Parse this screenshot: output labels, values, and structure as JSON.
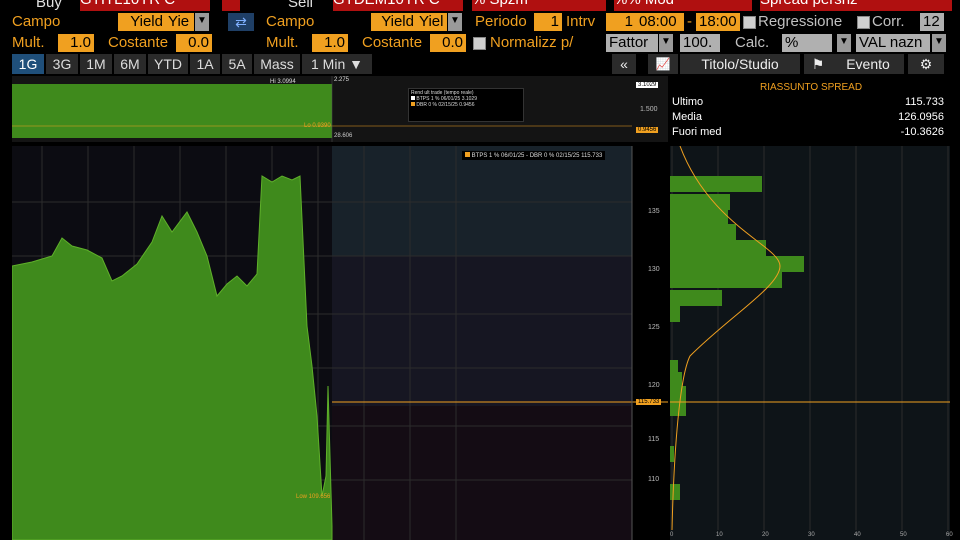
{
  "top": {
    "buy_label": "Buy",
    "buy_ticker": "GTITL10YR C",
    "sell_label": "Sell",
    "sell_ticker": "GTDEM10YR C",
    "mode1": "% Spzm",
    "mode2": "%% Mod",
    "spread_label": "Spread persnz"
  },
  "row1": {
    "campo1_label": "Campo",
    "campo1_value": "Yield",
    "campo1_value2": "Yie",
    "campo2_label": "Campo",
    "campo2_value": "Yield",
    "campo2_value2": "Yiel",
    "periodo_label": "Periodo",
    "periodo_value": "1",
    "intrv_label": "Intrv",
    "intrv_value": "1",
    "time_from": "08:00",
    "time_to": "18:00",
    "regressione_label": "Regressione",
    "corr_label": "Corr.",
    "corr_value": "12"
  },
  "row2": {
    "mult1_label": "Mult.",
    "mult1_value": "1.0",
    "costante1_label": "Costante",
    "costante1_value": "0.0",
    "mult2_label": "Mult.",
    "mult2_value": "1.0",
    "costante2_label": "Costante",
    "costante2_value": "0.0",
    "normalizz_label": "Normalizz p/",
    "fattor_label": "Fattor",
    "fattor_value": "100.",
    "calc_label": "Calc.",
    "calc_value": "%",
    "val_label": "VAL nazn"
  },
  "tabs": [
    "1G",
    "3G",
    "1M",
    "6M",
    "YTD",
    "1A",
    "5A",
    "Mass",
    "1 Min"
  ],
  "toolbar": {
    "collapse": "«",
    "titolo_studio": "Titolo/Studio",
    "evento": "Evento"
  },
  "overview": {
    "legend_title": "Rend ult trade (tempo reale)",
    "legend_btps": "BTPS 1 % 06/01/25  3.1029",
    "legend_dbr": "DBR 0 % 02/15/25  0.9456",
    "right_val_top": "3.1029",
    "right_val_mid": "1.500",
    "right_val_bot": "0.9456",
    "hint_left": "Hi  3.0994",
    "hint_mid": "Lo  0.9390",
    "hint_top": "2.275",
    "hint_bot": "28.606"
  },
  "summary": {
    "title": "RIASSUNTO SPREAD",
    "rows": [
      {
        "label": "Ultimo",
        "value": "115.733"
      },
      {
        "label": "Media",
        "value": "126.0956"
      },
      {
        "label": "Fuori med",
        "value": "-10.3626"
      }
    ]
  },
  "main_chart": {
    "legend": "BTPS 1 % 06/01/25 - DBR 0 % 02/15/25  115.733",
    "y_ticks": [
      "135",
      "130",
      "125",
      "120",
      "115",
      "110"
    ],
    "last_value_tag": "115.733",
    "low_label": "Low  109.656"
  },
  "histogram": {
    "x_ticks": [
      "0",
      "10",
      "20",
      "30",
      "40",
      "50",
      "60"
    ]
  },
  "colors": {
    "accent_orange": "#f0a020",
    "bar_green": "#3f8a1c",
    "tab_active": "#1f4f7a",
    "red": "#b01010"
  }
}
